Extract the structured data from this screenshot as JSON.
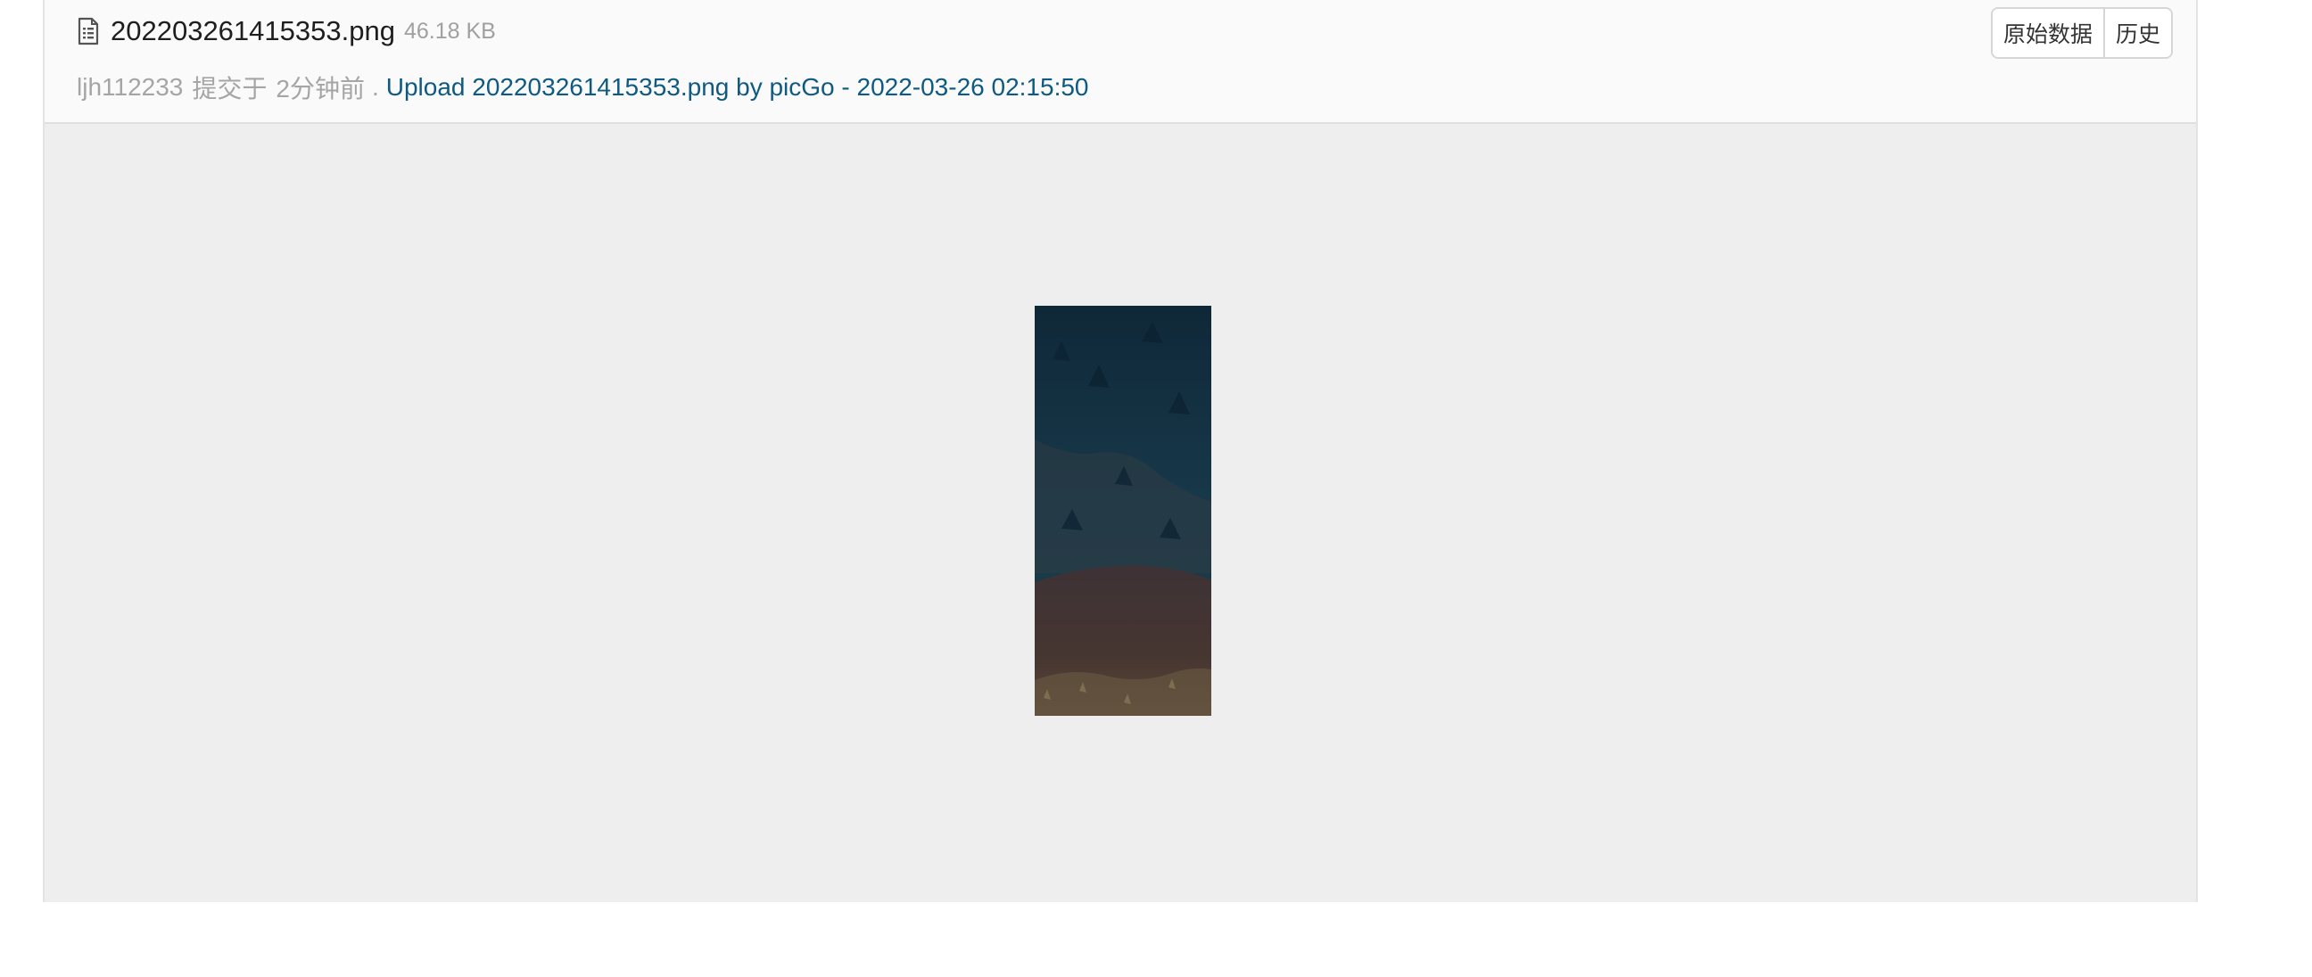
{
  "file": {
    "name": "202203261415353.png",
    "size": "46.18 KB",
    "icon": "file-text-icon"
  },
  "actions": {
    "raw_label": "原始数据",
    "history_label": "历史"
  },
  "commit": {
    "author": "ljh112233",
    "verb": "提交于",
    "time": "2分钟前",
    "separator": ".",
    "message": "Upload 202203261415353.png by picGo - 2022-03-26 02:15:50"
  },
  "colors": {
    "link": "#0f5a82",
    "muted": "#a5a5a5",
    "viewer_bg": "#eeeeee",
    "header_bg": "#fafafa"
  }
}
